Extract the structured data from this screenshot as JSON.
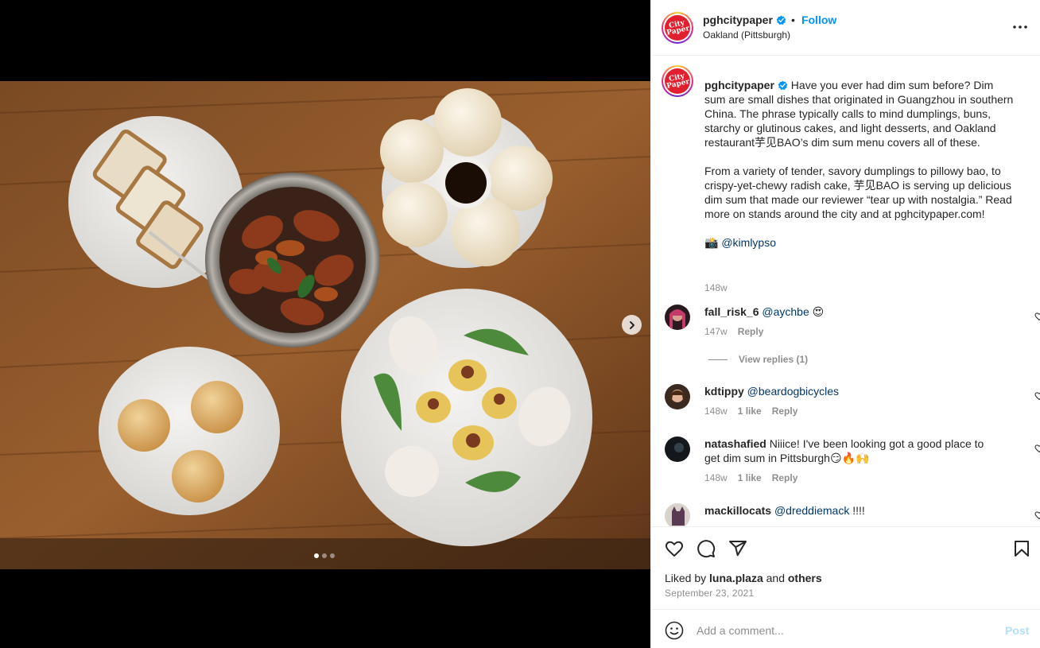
{
  "post": {
    "username": "pghcitypaper",
    "logo_text": "City Paper",
    "verified": true,
    "follow_label": "Follow",
    "separator": "•",
    "location": "Oakland (Pittsburgh)",
    "media": {
      "slide_count": 3,
      "active_slide": 1
    }
  },
  "caption": {
    "username": "pghcitypaper",
    "paragraph_1": " Have you ever had dim sum before? Dim sum are small dishes that originated in Guangzhou in southern China. The phrase typically calls to mind dumplings, buns, starchy or glutinous cakes, and light desserts, and Oakland restaurant芋见BAO’s dim sum menu covers all of these.",
    "paragraph_2": "From a variety of tender, savory dumplings to pillowy bao, to crispy-yet-chewy radish cake, 芋见BAO is serving up delicious dim sum that made our reviewer “tear up with nostalgia.” Read more on stands around the city and at pghcitypaper.com!",
    "photo_credit_emoji": "📸",
    "photo_credit": "@kimlypso",
    "time": "148w"
  },
  "comments": [
    {
      "username": "fall_risk_6",
      "mention": "@aychbe",
      "text": " 😍",
      "time": "147w",
      "likes": "",
      "reply_label": "Reply"
    },
    {
      "username": "kdtippy",
      "mention": "@beardogbicycles",
      "text": "",
      "time": "148w",
      "likes": "1 like",
      "reply_label": "Reply"
    },
    {
      "username": "natashafied",
      "mention": "",
      "text": " Niiice! I've been looking got a good place to get dim sum in Pittsburgh😏🔥🙌",
      "time": "148w",
      "likes": "1 like",
      "reply_label": "Reply"
    },
    {
      "username": "mackillocats",
      "mention": "@dreddiemack",
      "text": " !!!!",
      "time": "",
      "likes": "",
      "reply_label": ""
    }
  ],
  "view_replies_label": "View replies (1)",
  "likes": {
    "prefix": "Liked by ",
    "user": "luna.plaza",
    "middle": " and ",
    "others": "others"
  },
  "date": "September 23, 2021",
  "add_comment": {
    "placeholder": "Add a comment...",
    "post_label": "Post"
  },
  "icons": {
    "more": "more-horizontal-icon",
    "like": "heart-icon",
    "comment": "comment-bubble-icon",
    "share": "paper-plane-icon",
    "save": "bookmark-icon",
    "emoji": "smiley-face-icon",
    "next": "chevron-right-icon",
    "verified": "verified-badge-icon"
  },
  "colors": {
    "link_blue": "#0095f6",
    "mention_blue": "#00376b",
    "secondary_text": "#8e8e8e",
    "post_disabled": "#b2dffc",
    "brand_red": "#e0202e"
  }
}
